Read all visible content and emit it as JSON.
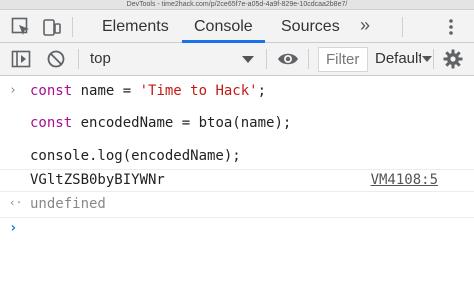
{
  "window": {
    "title": "DevTools - time2hack.com/p/2ce65f7e-a05d-4a9f-829e-10cdcaa2b8e7/"
  },
  "tabbar": {
    "tabs": [
      {
        "label": "Elements",
        "active": false
      },
      {
        "label": "Console",
        "active": true
      },
      {
        "label": "Sources",
        "active": false
      }
    ],
    "more_label": "»"
  },
  "toolbar": {
    "context": "top",
    "filter_placeholder": "Filter",
    "levels": "Default levels"
  },
  "console": {
    "entries": [
      {
        "type": "input",
        "prompt": "›",
        "keyword": "const",
        "name": " name = ",
        "string": "'Time to Hack'",
        "tail": ";"
      },
      {
        "type": "input",
        "keyword": "const",
        "rest": " encodedName = btoa(name);"
      },
      {
        "type": "input",
        "code": "console.log(encodedName);"
      },
      {
        "type": "log",
        "text": "VGltZSB0byBIYWNr",
        "source": "VM4108:5"
      },
      {
        "type": "result",
        "prompt": "‹·",
        "text": "undefined"
      }
    ],
    "input_prompt": "›"
  },
  "colors": {
    "accent": "#1a73e8",
    "keyword": "#aa0d91",
    "string": "#c41a16"
  }
}
